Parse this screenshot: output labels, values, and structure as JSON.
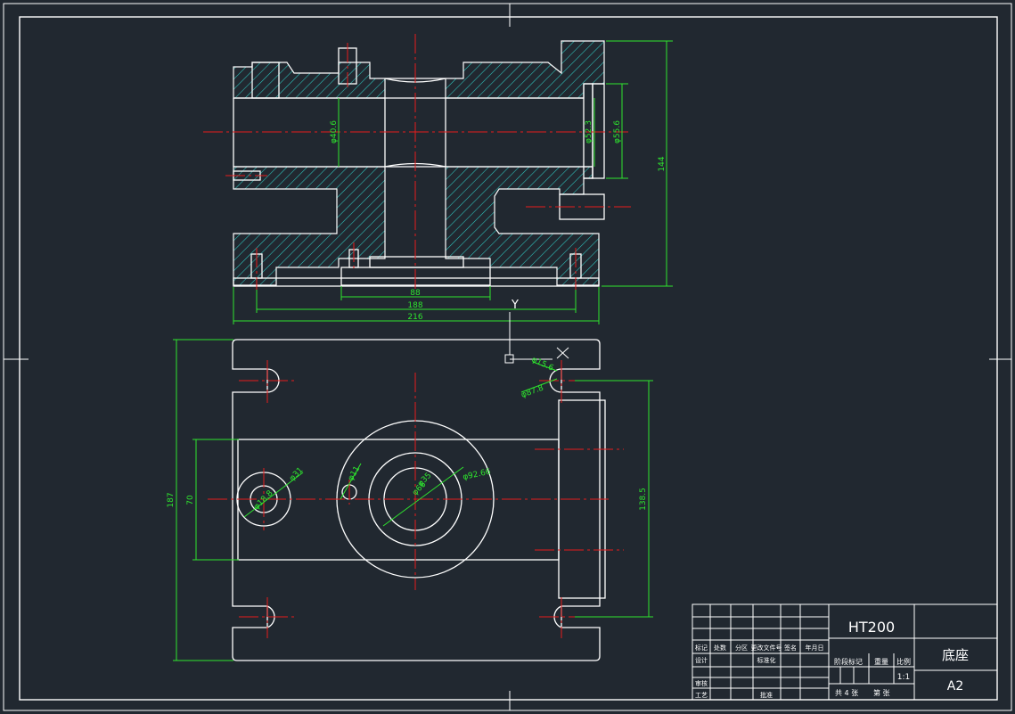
{
  "colors": {
    "background": "#212830",
    "outline": "#ffffff",
    "hatch": "#2fc9c2",
    "dimension": "#2ee62e",
    "centerline": "#e81c1c"
  },
  "front_view": {
    "dimensions": {
      "bore_small": "φ40.6",
      "bore_mid": "φ52.3",
      "bore_large": "φ55.6",
      "height": "144",
      "bottom_inner": "88",
      "bottom_mid": "188",
      "bottom_total": "216"
    }
  },
  "section_marker": "Y",
  "plan_view": {
    "dimensions": {
      "slot_a": "φ15.6",
      "slot_b": "φ87.8",
      "total_height": "187",
      "boss_height": "70",
      "right_span": "138.5",
      "small_hole_a": "φ18.8",
      "small_hole_b": "φ31",
      "pin_hole": "φ11",
      "center_a": "φ35",
      "center_b": "φ66",
      "outer_ring": "φ92.66"
    }
  },
  "title_block": {
    "material": "HT200",
    "part_name": "底座",
    "scale": "1:1",
    "sheet_size": "A2",
    "row_header": [
      "标记",
      "处数",
      "分区",
      "更改文件号",
      "签名",
      "年月日"
    ],
    "design": "设计",
    "standardize": "标准化",
    "stage_mark": "阶段标记",
    "weight": "重量",
    "ratio": "比例",
    "review": "审核",
    "process": "工艺",
    "approve": "批准",
    "sheet_total": "共 4 张",
    "sheet_no": "第  张"
  }
}
